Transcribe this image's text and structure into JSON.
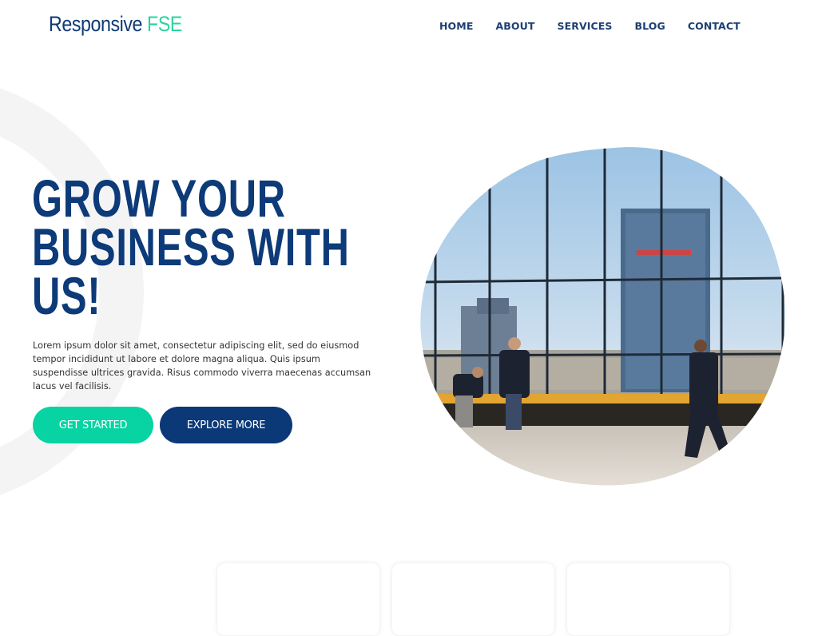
{
  "header": {
    "logo": {
      "primary": "Responsive",
      "accent": "FSE"
    },
    "nav": [
      {
        "label": "HOME"
      },
      {
        "label": "ABOUT"
      },
      {
        "label": "SERVICES"
      },
      {
        "label": "BLOG"
      },
      {
        "label": "CONTACT"
      }
    ]
  },
  "hero": {
    "title_lines": [
      "GROW YOUR",
      "BUSINESS WITH",
      "US!"
    ],
    "description": "Lorem ipsum dolor sit amet, consectetur adipiscing elit, sed do eiusmod tempor incididunt ut labore et dolore magna aliqua. Quis ipsum suspendisse ultrices gravida. Risus commodo viverra maecenas accumsan lacus vel facilisis.",
    "primary_button": "GET STARTED",
    "secondary_button": "EXPLORE MORE",
    "image_alt": "Business people in a glass-walled skyscraper office overlooking the city"
  },
  "colors": {
    "brand_navy": "#0d3a78",
    "brand_teal": "#08d3a3",
    "nav_text": "#1d3f72",
    "ring": "#f4f4f5"
  },
  "cards": [
    {},
    {},
    {}
  ]
}
